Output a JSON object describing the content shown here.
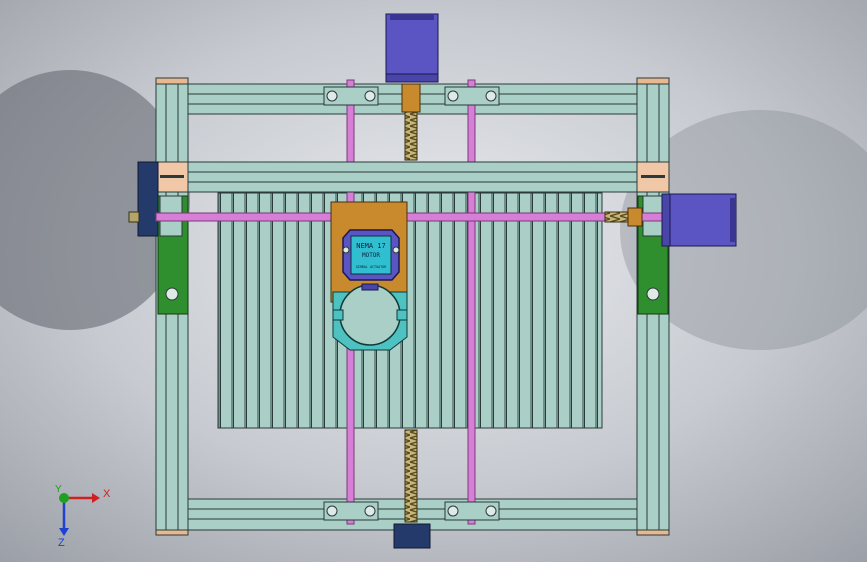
{
  "viewport": {
    "description_free": true
  },
  "motor_label": {
    "line1": "NEMA 17",
    "line2": "MOTOR",
    "line3": "GIMBAL ACTUATOR"
  },
  "axis_triad": {
    "x_label": "X",
    "y_label": "Y",
    "z_label": "Z"
  },
  "colors": {
    "frame_rail": "#a9cfc7",
    "rail_edge": "#2b3a3a",
    "smooth_rod": "#d77fd6",
    "lead_screw": "#b0a060",
    "stepper_motor": "#5b55c4",
    "bearing_block": "#f0c8a8",
    "carriage_plate": "#c98a2e",
    "spindle_clamp": "#4ec2c0",
    "side_plate": "#2f8f2f",
    "x_axis": "#d02020",
    "y_axis": "#20a020",
    "z_axis": "#2040d0"
  }
}
